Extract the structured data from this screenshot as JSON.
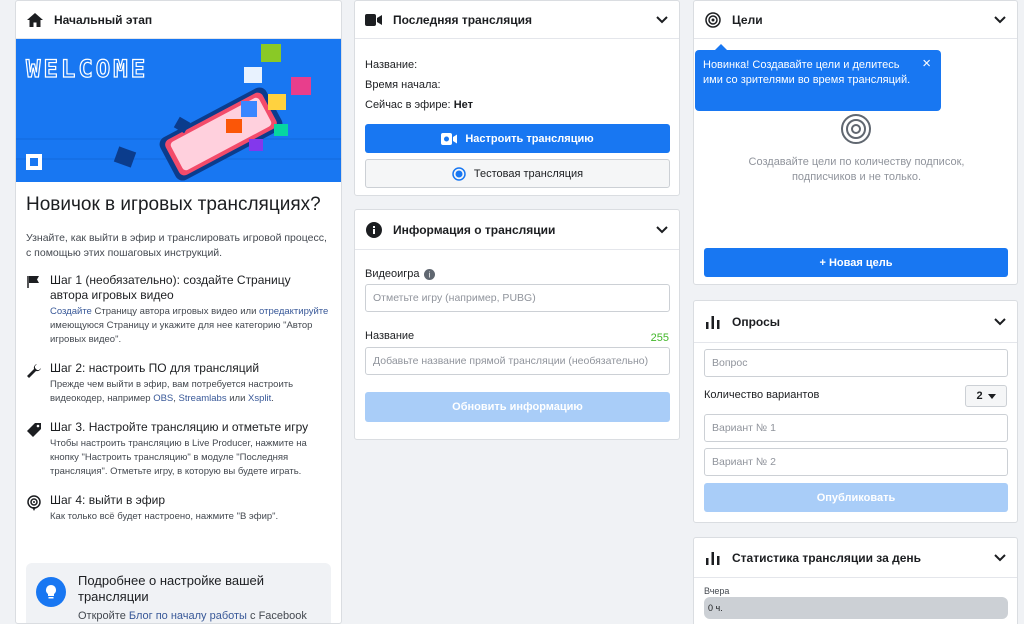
{
  "getting_started": {
    "header": "Начальный этап",
    "banner_text": "WELCOME",
    "heading": "Новичок в игровых трансляциях?",
    "intro": "Узнайте, как выйти в эфир и транслировать игровой процесс, с помощью этих пошаговых инструкций.",
    "steps": [
      {
        "title": "Шаг 1 (необязательно): создайте Страницу автора игровых видео",
        "link1": "Создайте",
        "text1": " Страницу автора игровых видео или ",
        "link2": "отредактируйте",
        "text2": " имеющуюся Страницу и укажите для нее категорию \"Автор игровых видео\"."
      },
      {
        "title": "Шаг 2: настроить ПО для трансляций",
        "text1": "Прежде чем выйти в эфир, вам потребуется настроить видеокодер, например ",
        "link1": "OBS",
        "sep1": ", ",
        "link2": "Streamlabs",
        "sep2": " или ",
        "link3": "Xsplit",
        "end": "."
      },
      {
        "title": "Шаг 3. Настройте трансляцию и отметьте игру",
        "text1": "Чтобы настроить трансляцию в Live Producer, нажмите на кнопку \"Настроить трансляцию\" в модуле \"Последняя трансляция\". Отметьте игру, в которую вы будете играть."
      },
      {
        "title": "Шаг 4: выйти в эфир",
        "text1": "Как только всё будет настроено, нажмите \"В эфир\"."
      }
    ],
    "more": {
      "title": "Подробнее о настройке вашей трансляции",
      "text_pre": "Откройте ",
      "link": "Блог по началу работы",
      "text_post": " с Facebook"
    }
  },
  "last_broadcast": {
    "header": "Последняя трансляция",
    "name_label": "Название:",
    "start_label": "Время начала:",
    "live_label": "Сейчас в эфире:",
    "live_value": "Нет",
    "setup_button": "Настроить трансляцию",
    "test_button": "Тестовая трансляция"
  },
  "broadcast_info": {
    "header": "Информация о трансляции",
    "game_label": "Видеоигра",
    "game_placeholder": "Отметьте игру (например, PUBG)",
    "title_label": "Название",
    "title_counter": "255",
    "title_placeholder": "Добавьте название прямой трансляции (необязательно)",
    "update_button": "Обновить информацию"
  },
  "goals": {
    "header": "Цели",
    "tooltip": "Новинка! Создавайте цели и делитесь ими со зрителями во время трансляций.",
    "tooltip_close": "×",
    "description": "Создавайте цели по количеству подписок, подписчиков и не только.",
    "new_goal_button": "+ Новая цель"
  },
  "polls": {
    "header": "Опросы",
    "question_placeholder": "Вопрос",
    "options_label": "Количество вариантов",
    "options_count": "2",
    "option1_placeholder": "Вариант № 1",
    "option2_placeholder": "Вариант № 2",
    "publish_button": "Опубликовать"
  },
  "stats": {
    "header": "Статистика трансляции за день",
    "yesterday_label": "Вчера",
    "yesterday_value": "0 ч."
  },
  "colors": {
    "accent": "#1877f2",
    "accent_disabled": "#a9cdf8",
    "link": "#385898",
    "counter": "#42b72a"
  }
}
